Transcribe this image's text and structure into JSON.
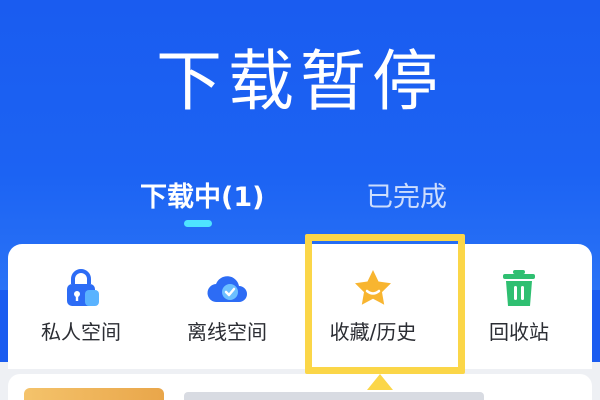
{
  "header": {
    "title": "下载暂停"
  },
  "tabs": [
    {
      "label": "下载中(1)",
      "active": true
    },
    {
      "label": "已完成",
      "active": false
    }
  ],
  "shortcuts": [
    {
      "label": "私人空间",
      "icon": "lock-icon",
      "color": "#2d6cf5"
    },
    {
      "label": "离线空间",
      "icon": "cloud-check-icon",
      "color": "#2d6cf5"
    },
    {
      "label": "收藏/历史",
      "icon": "star-icon",
      "color": "#f8b530"
    },
    {
      "label": "回收站",
      "icon": "trash-icon",
      "color": "#2fbf71"
    }
  ],
  "colors": {
    "header_bg": "#1a5cf0",
    "tab_indicator": "#4ee3ff",
    "highlight": "#fbd648"
  }
}
